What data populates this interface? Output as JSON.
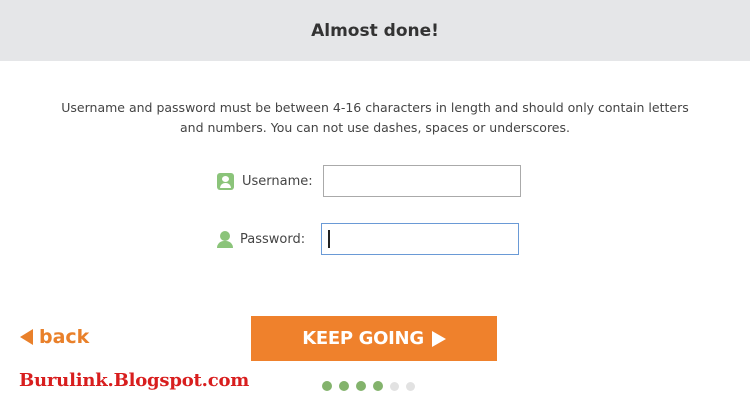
{
  "header": {
    "title": "Almost done!"
  },
  "instructions": "Username and password must be between 4-16 characters in length and should only contain letters and numbers. You can not use dashes, spaces or underscores.",
  "form": {
    "username": {
      "label": "Username:",
      "value": "",
      "icon": "user-card-icon"
    },
    "password": {
      "label": "Password:",
      "value": "",
      "icon": "person-icon"
    }
  },
  "nav": {
    "back_label": "back",
    "continue_label": "KEEP GOING"
  },
  "watermark": "Burulink.Blogspot.com",
  "progress": {
    "total_steps": 6,
    "completed_steps": 4
  },
  "colors": {
    "accent": "#ef812c",
    "icon_green": "#8bc47a",
    "header_bg": "#e5e6e8",
    "watermark_red": "#d81e1e"
  }
}
